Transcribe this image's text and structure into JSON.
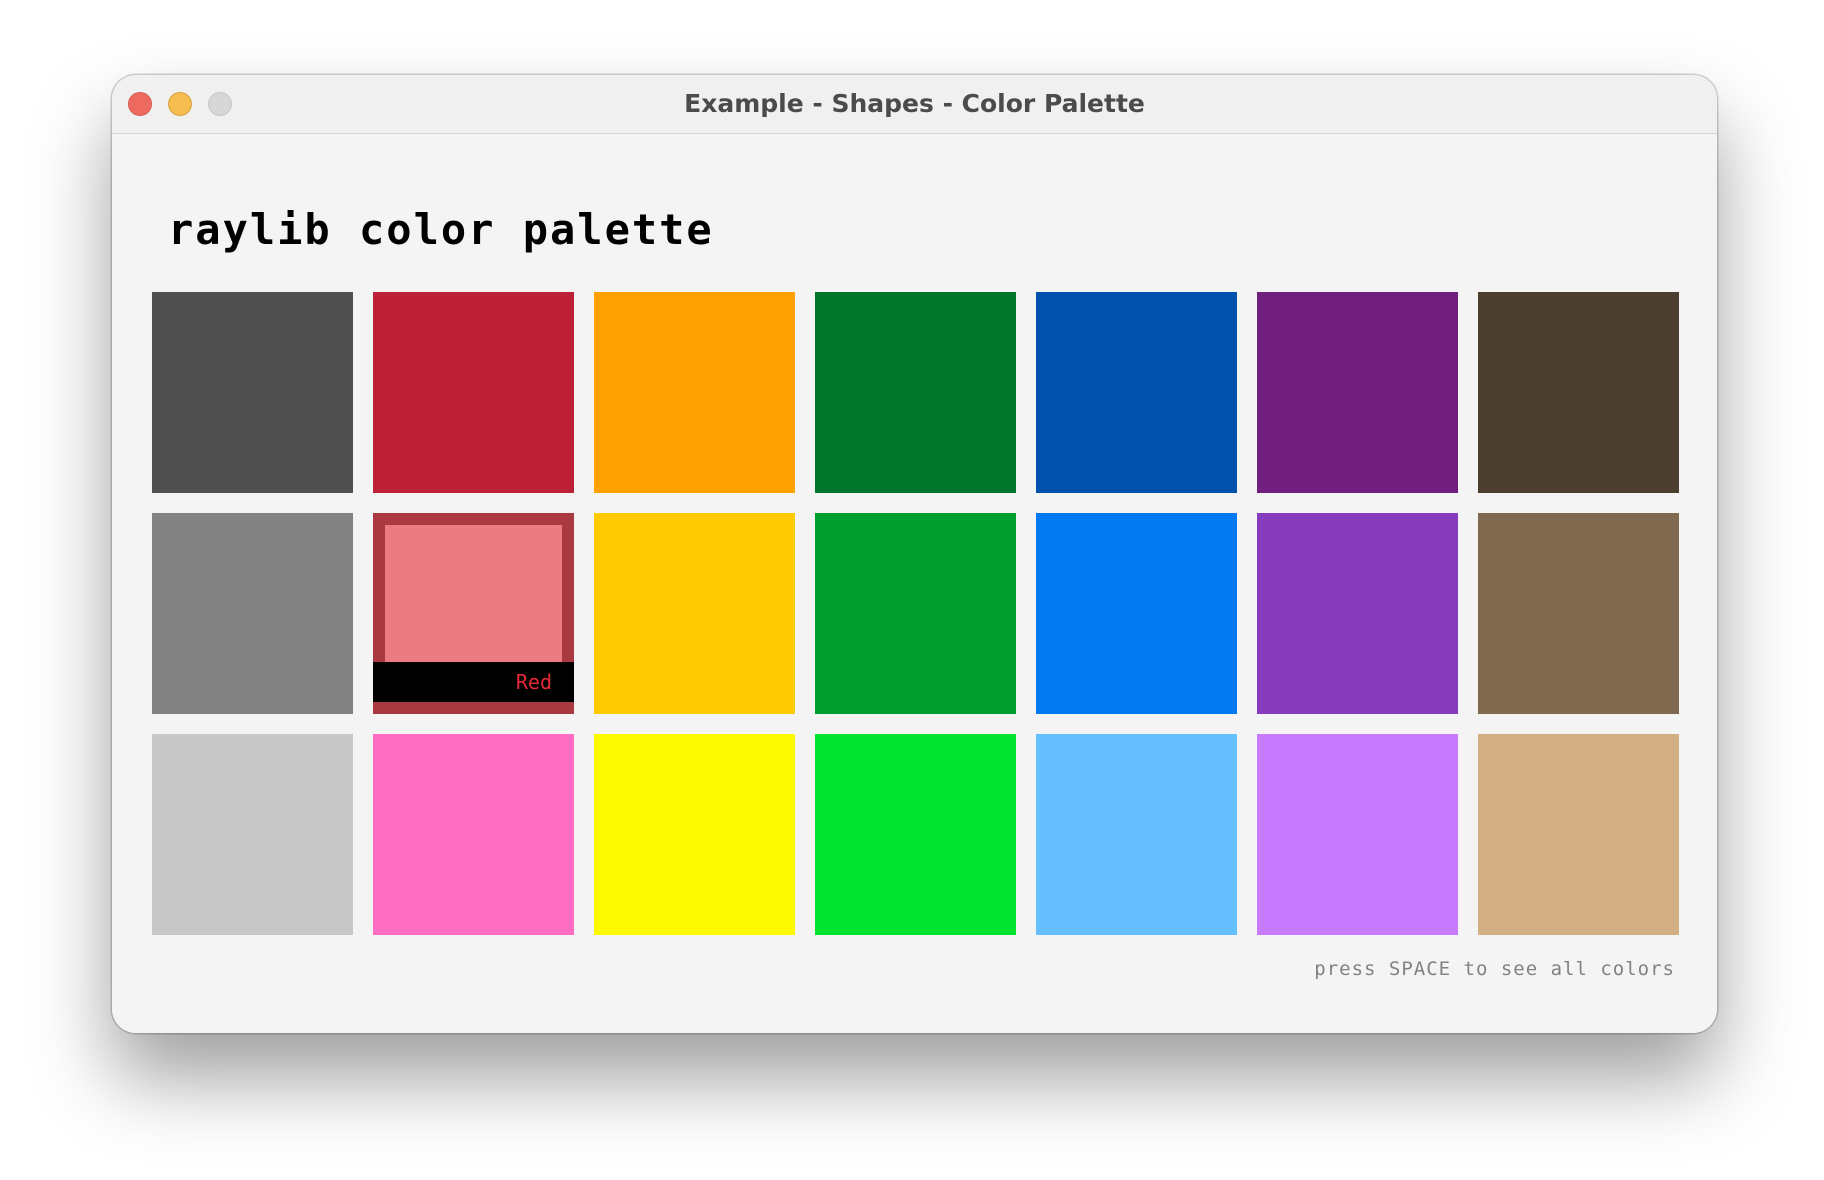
{
  "window": {
    "title": "Example - Shapes - Color Palette"
  },
  "heading": "raylib color palette",
  "hint": "press SPACE to see all colors",
  "hovered_index": 8,
  "colors": [
    {
      "name": "DarkGray",
      "hex": "#505050"
    },
    {
      "name": "Maroon",
      "hex": "#be2137"
    },
    {
      "name": "Orange",
      "hex": "#ffa100"
    },
    {
      "name": "DarkGreen",
      "hex": "#00752c"
    },
    {
      "name": "DarkBlue",
      "hex": "#0052ac"
    },
    {
      "name": "DarkPurple",
      "hex": "#701f7e"
    },
    {
      "name": "DarkBrown",
      "hex": "#4c3f2f"
    },
    {
      "name": "Gray",
      "hex": "#828282"
    },
    {
      "name": "Red",
      "hex": "#e62937",
      "label": "Red"
    },
    {
      "name": "Gold",
      "hex": "#ffcb00"
    },
    {
      "name": "Green",
      "hex": "#009e2f"
    },
    {
      "name": "Blue",
      "hex": "#0079f1"
    },
    {
      "name": "Purple",
      "hex": "#873cbe"
    },
    {
      "name": "Brown",
      "hex": "#7f6a4f"
    },
    {
      "name": "LightGray",
      "hex": "#c8c8c8"
    },
    {
      "name": "Pink",
      "hex": "#ff6dc2"
    },
    {
      "name": "Yellow",
      "hex": "#fdf900"
    },
    {
      "name": "Lime",
      "hex": "#00e430"
    },
    {
      "name": "SkyBlue",
      "hex": "#66bfff"
    },
    {
      "name": "Violet",
      "hex": "#c87aff"
    },
    {
      "name": "Beige",
      "hex": "#d3b083"
    }
  ]
}
